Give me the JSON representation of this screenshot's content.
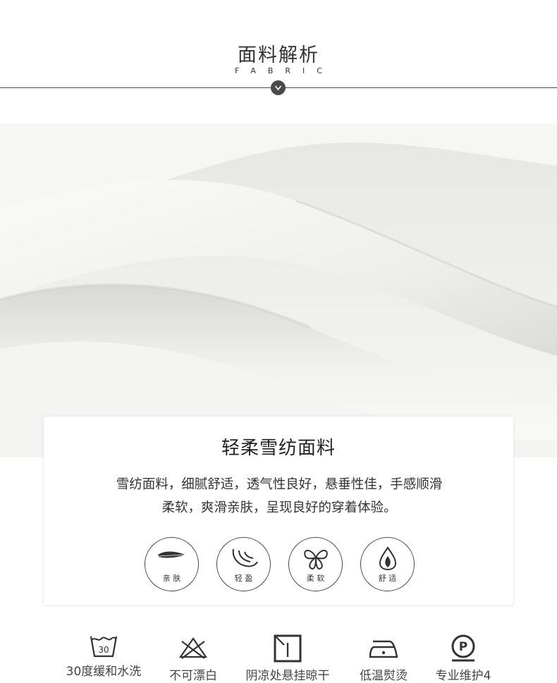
{
  "header": {
    "title": "面料解析",
    "subtitle": "FABRIC"
  },
  "card": {
    "title": "轻柔雪纺面料",
    "desc_line1": "雪纺面料，细腻舒适，透气性良好，悬垂性佳，手感顺滑",
    "desc_line2": "柔软，爽滑亲肤，呈现良好的穿着体验。",
    "features": [
      {
        "icon": "feather-icon",
        "label": "亲 肤"
      },
      {
        "icon": "leaf-icon",
        "label": "轻 盈"
      },
      {
        "icon": "butterfly-icon",
        "label": "柔 软"
      },
      {
        "icon": "drop-leaf-icon",
        "label": "舒 适"
      }
    ]
  },
  "care": [
    {
      "icon": "wash-30-icon",
      "label": "30度缓和水洗",
      "icon_text": "30"
    },
    {
      "icon": "no-bleach-icon",
      "label": "不可漂白"
    },
    {
      "icon": "shade-dry-icon",
      "label": "阴凉处悬挂晾干"
    },
    {
      "icon": "low-iron-icon",
      "label": "低温熨烫"
    },
    {
      "icon": "professional-care-icon",
      "label": "专业维护4",
      "icon_text": "P"
    }
  ],
  "colors": {
    "line": "#4a4a4a",
    "text": "#333333",
    "fabric": "#f3f3f1"
  }
}
